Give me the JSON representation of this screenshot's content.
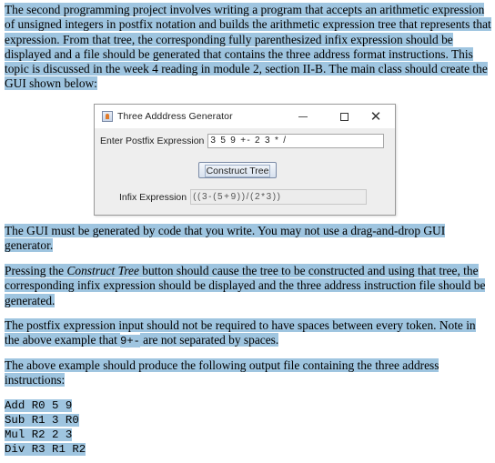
{
  "intro_paragraph": "The second programming project involves writing a program that accepts an arithmetic expression of unsigned integers in postfix notation and builds the arithmetic expression tree that represents that expression. From that tree, the corresponding fully parenthesized infix expression should be displayed and a file should be generated that contains the three address format instructions. This topic is discussed in the week 4 reading in module 2, section II-B. The main class should create the GUI shown below:",
  "gui_window": {
    "title": "Three Adddress Generator",
    "icon": "java-cup-icon",
    "controls": {
      "minimize": "minimize-icon",
      "maximize": "maximize-icon",
      "close": "close-icon"
    },
    "postfix_label": "Enter Postfix Expression",
    "postfix_value": "3 5 9 +- 2 3 * /",
    "construct_button": "Construct Tree",
    "infix_label": "Infix Expression",
    "infix_value": "((3-(5+9))/(2*3))"
  },
  "paragraph_gui": "The GUI must be generated by code that you write. You may not use a drag-and-drop GUI generator.",
  "paragraph_pressing": {
    "before": "Pressing the ",
    "emphasis": "Construct Tree",
    "after": " button should cause the tree to be constructed and using that tree, the corresponding infix expression should be displayed and the three address instruction file should be generated."
  },
  "paragraph_spaces": {
    "before": "The postfix expression input should not be required to have spaces between every token. Note in the above example that ",
    "code": "9+-",
    "after": " are not separated by spaces."
  },
  "paragraph_output": "The above example should produce the following output file containing the three address instructions:",
  "output_instructions": [
    "Add R0 5 9",
    "Sub R1 3 R0",
    "Mul R2 2 3",
    "Div R3 R1 R2"
  ],
  "colors": {
    "text_highlight": "#9fc5e0",
    "window_background": "#eeeeee",
    "titlebar_background": "#ffffff"
  }
}
